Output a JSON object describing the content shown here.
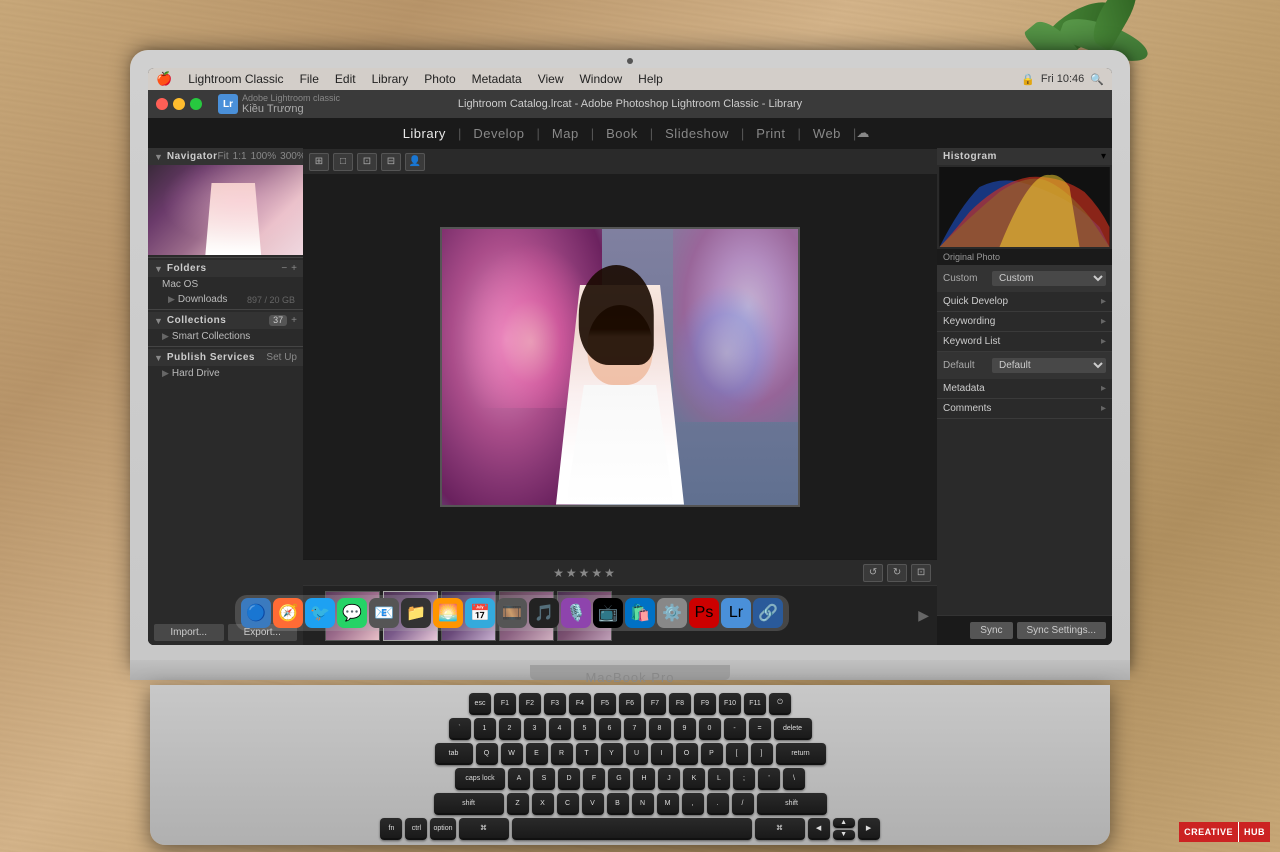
{
  "background": {
    "color": "#b8956a"
  },
  "macos": {
    "menubar": {
      "apple": "🍎",
      "items": [
        "Lightroom Classic",
        "File",
        "Edit",
        "Library",
        "Photo",
        "Metadata",
        "View",
        "Window",
        "Help"
      ],
      "right": [
        "Fri 10:46"
      ]
    }
  },
  "lightroom": {
    "titlebar": {
      "title": "Lightroom Catalog.lrcat - Adobe Photoshop Lightroom Classic - Library"
    },
    "user": {
      "name": "Kiều Trương"
    },
    "modules": [
      "Library",
      "Develop",
      "Map",
      "Book",
      "Slideshow",
      "Print",
      "Web"
    ],
    "left_panel": {
      "navigator": "Navigator",
      "zoom_levels": [
        "Fit",
        "1:1",
        "100%",
        "300%"
      ],
      "folders": {
        "title": "Folders",
        "items": [
          {
            "name": "Mac OS",
            "size": ""
          },
          {
            "name": "Downloads",
            "size": "897 / 20 GB"
          }
        ]
      },
      "collections": {
        "title": "Collections",
        "badge": "37"
      },
      "smart_collections": "Smart Collections",
      "publish_services": {
        "title": "Publish Services",
        "items": [
          "Hard Drive"
        ]
      },
      "setup": "Set Up",
      "import_btn": "Import...",
      "export_btn": "Export..."
    },
    "right_panel": {
      "histogram": "Histogram",
      "original_photo": "Original Photo",
      "custom_label": "Custom",
      "quick_develop": "Quick Develop",
      "keywording": "Keywording",
      "keyword_list": "Keyword List",
      "default_label": "Default",
      "metadata": "Metadata",
      "comments": "Comments",
      "sync_btn": "Sync",
      "sync_settings_btn": "Sync Settings..."
    },
    "toolbar": {
      "stars": [
        "★",
        "★",
        "★",
        "★",
        "★"
      ]
    }
  },
  "macbook": {
    "label": "MacBook Pro"
  },
  "watermark": {
    "creative": "CREATIVE",
    "hub": "HUB"
  }
}
